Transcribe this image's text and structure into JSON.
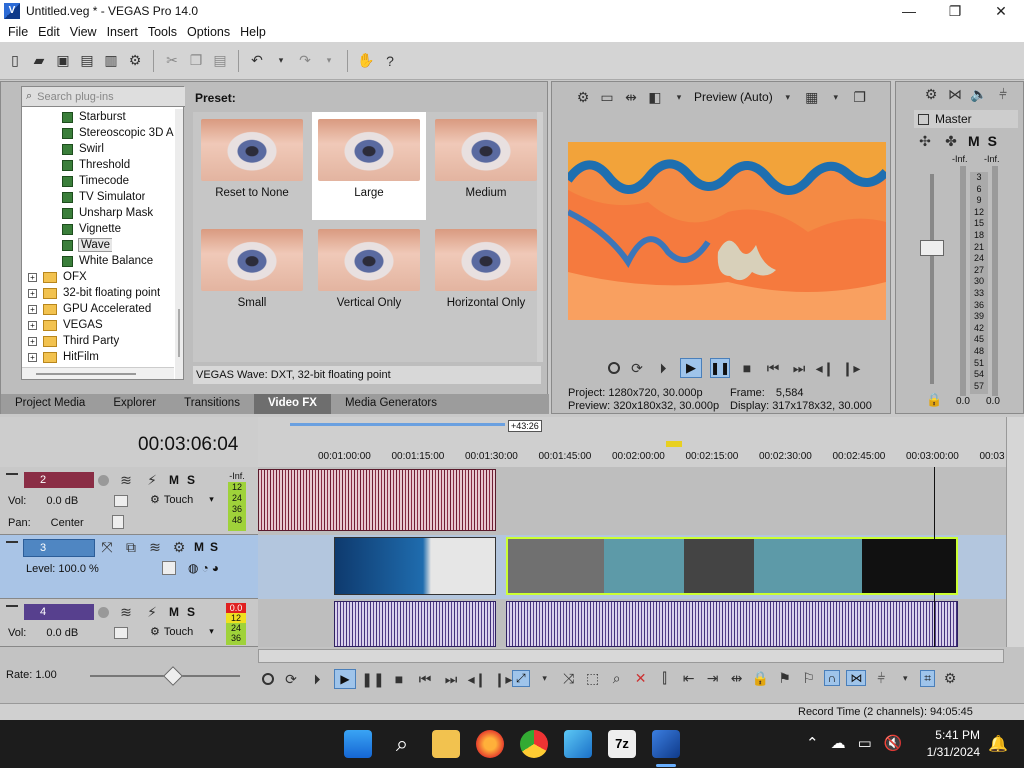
{
  "window": {
    "title": "Untitled.veg * - VEGAS Pro 14.0",
    "minimize": "—",
    "maximize": "❐",
    "close": "✕"
  },
  "menu": [
    "File",
    "Edit",
    "View",
    "Insert",
    "Tools",
    "Options",
    "Help"
  ],
  "fx_panel": {
    "search_placeholder": "Search plug-ins",
    "tree": [
      {
        "label": "Starburst",
        "type": "fx"
      },
      {
        "label": "Stereoscopic 3D A",
        "type": "fx"
      },
      {
        "label": "Swirl",
        "type": "fx"
      },
      {
        "label": "Threshold",
        "type": "fx"
      },
      {
        "label": "Timecode",
        "type": "fx"
      },
      {
        "label": "TV Simulator",
        "type": "fx"
      },
      {
        "label": "Unsharp Mask",
        "type": "fx"
      },
      {
        "label": "Vignette",
        "type": "fx"
      },
      {
        "label": "Wave",
        "type": "fx",
        "selected": true
      },
      {
        "label": "White Balance",
        "type": "fx"
      },
      {
        "label": "OFX",
        "type": "folder"
      },
      {
        "label": "32-bit floating point",
        "type": "folder"
      },
      {
        "label": "GPU Accelerated",
        "type": "folder"
      },
      {
        "label": "VEGAS",
        "type": "folder"
      },
      {
        "label": "Third Party",
        "type": "folder"
      },
      {
        "label": "HitFilm",
        "type": "folder"
      }
    ],
    "preset_label": "Preset:",
    "presets": [
      "Reset to None",
      "Large",
      "Medium",
      "Small",
      "Vertical Only",
      "Horizontal Only"
    ],
    "active_preset": "Large",
    "description": "VEGAS Wave: DXT, 32-bit floating point",
    "tabs": [
      "Project Media",
      "Explorer",
      "Transitions",
      "Video FX",
      "Media Generators"
    ],
    "active_tab": "Video FX"
  },
  "preview": {
    "quality": "Preview (Auto)",
    "project_label": "Project:",
    "project_value": "1280x720, 30.000p",
    "preview_label": "Preview:",
    "preview_value": "320x180x32, 30.000p",
    "frame_label": "Frame:",
    "frame_value": "5,584",
    "display_label": "Display:",
    "display_value": "317x178x32, 30.000"
  },
  "master": {
    "label": "Master",
    "m": "M",
    "s": "S",
    "inf_left": "-Inf.",
    "inf_right": "-Inf.",
    "scale": [
      "3",
      "6",
      "9",
      "12",
      "15",
      "18",
      "21",
      "24",
      "27",
      "30",
      "33",
      "36",
      "39",
      "42",
      "45",
      "48",
      "51",
      "54",
      "57"
    ],
    "value_left": "0.0",
    "value_right": "0.0"
  },
  "timeline": {
    "timecode": "00:03:06:04",
    "region_length": "+43:26",
    "ruler": [
      "00:01:00:00",
      "00:01:15:00",
      "00:01:30:00",
      "00:01:45:00",
      "00:02:00:00",
      "00:02:15:00",
      "00:02:30:00",
      "00:02:45:00",
      "00:03:00:00",
      "00:03"
    ],
    "tracks": [
      {
        "num": "2",
        "vol_label": "Vol:",
        "vol": "0.0 dB",
        "pan_label": "Pan:",
        "pan": "Center",
        "mode": "Touch",
        "meter": [
          "-Inf.",
          "12",
          "24",
          "36",
          "48"
        ]
      },
      {
        "num": "3",
        "level_label": "Level:",
        "level": "100.0 %"
      },
      {
        "num": "4",
        "vol_label": "Vol:",
        "vol": "0.0 dB",
        "mode": "Touch",
        "meter": [
          "0.0",
          "12",
          "24",
          "36"
        ]
      }
    ],
    "rate_label": "Rate:",
    "rate": "1.00"
  },
  "status_bar": {
    "record_time": "Record Time (2 channels): 94:05:45"
  },
  "taskbar": {
    "time": "5:41 PM",
    "date": "1/31/2024"
  },
  "colors": {
    "accent": "#2f6fd1",
    "track_audio_red": "#8a2d45",
    "track_audio_purple": "#57408e",
    "selection": "#ccff33"
  }
}
